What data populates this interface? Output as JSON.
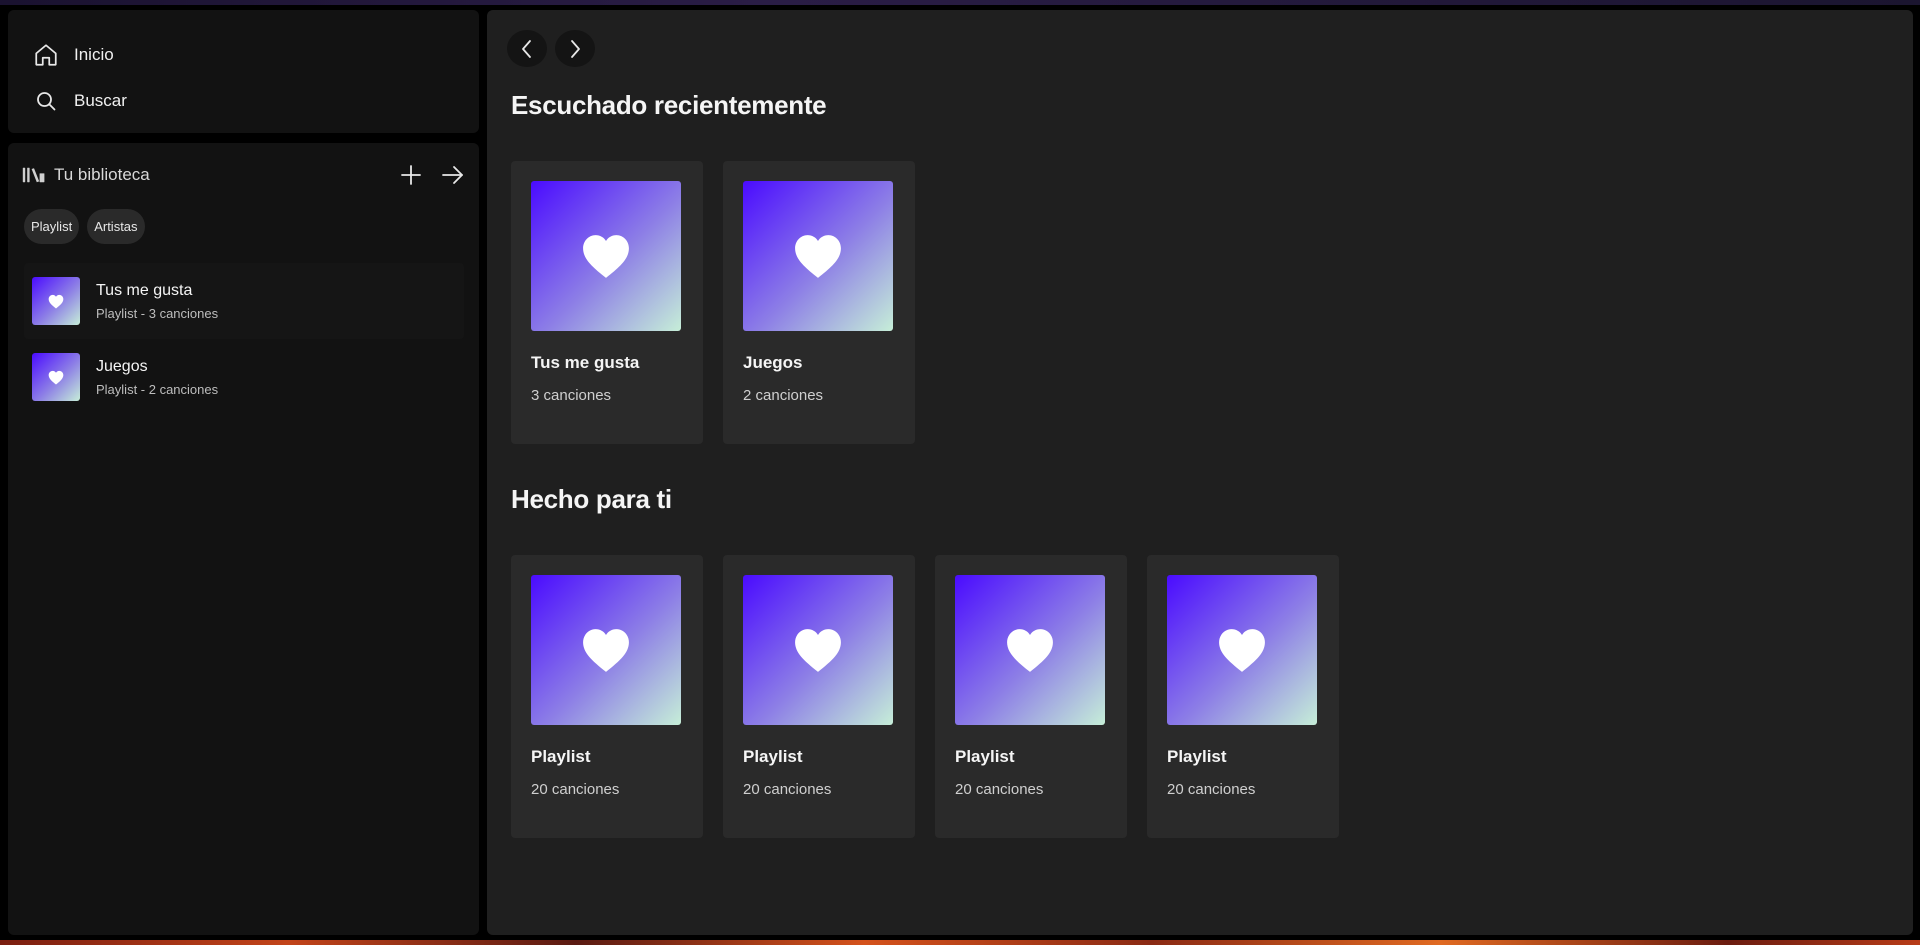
{
  "nav": {
    "items": [
      {
        "label": "Inicio",
        "icon": "home-icon"
      },
      {
        "label": "Buscar",
        "icon": "search-icon"
      }
    ]
  },
  "library": {
    "title": "Tu biblioteca",
    "filters": [
      "Playlist",
      "Artistas"
    ],
    "items": [
      {
        "name": "Tus me gusta",
        "subtitle": "Playlist - 3 canciones"
      },
      {
        "name": "Juegos",
        "subtitle": "Playlist - 2 canciones"
      }
    ]
  },
  "main": {
    "recent": {
      "title": "Escuchado recientemente",
      "cards": [
        {
          "title": "Tus me gusta",
          "subtitle": "3 canciones"
        },
        {
          "title": "Juegos",
          "subtitle": "2 canciones"
        }
      ]
    },
    "made_for_you": {
      "title": "Hecho para ti",
      "cards": [
        {
          "title": "Playlist",
          "subtitle": "20 canciones"
        },
        {
          "title": "Playlist",
          "subtitle": "20 canciones"
        },
        {
          "title": "Playlist",
          "subtitle": "20 canciones"
        },
        {
          "title": "Playlist",
          "subtitle": "20 canciones"
        }
      ]
    }
  },
  "colors": {
    "cover_gradient": [
      "#4a0bff",
      "#8d7fe6",
      "#c6eed8"
    ],
    "panel": "#121212",
    "main_bg": "#1f1f1f",
    "card_bg": "#2a2a2a"
  }
}
